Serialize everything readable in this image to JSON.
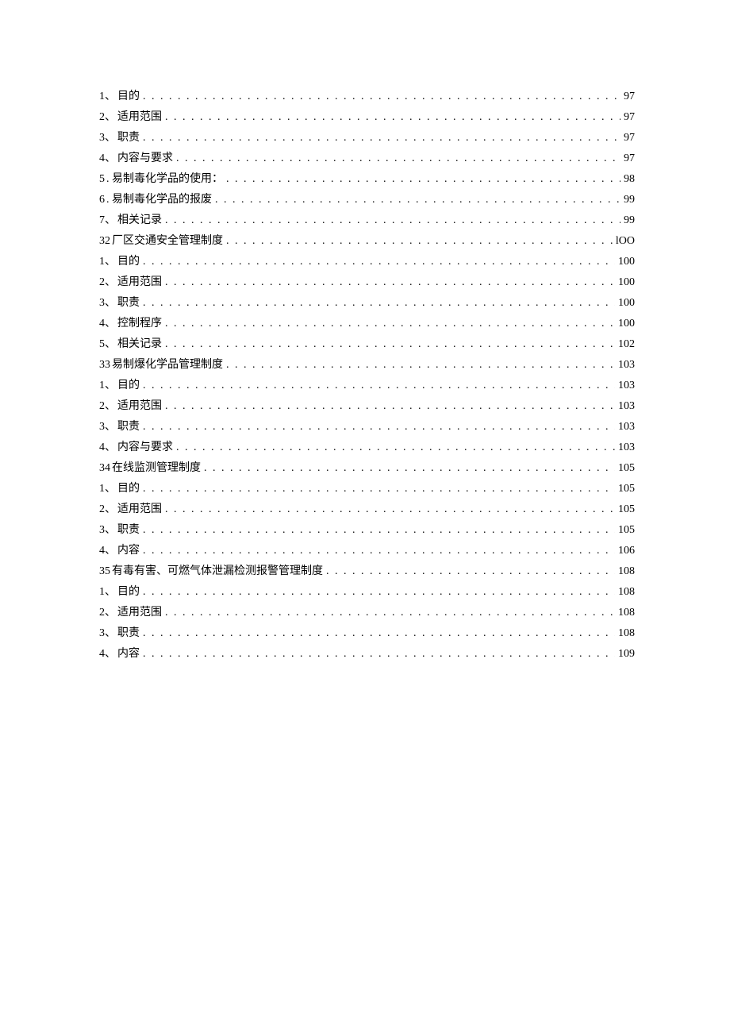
{
  "toc": [
    {
      "prefix": "1、",
      "title": "目的",
      "page": "97"
    },
    {
      "prefix": "2、",
      "title": "适用范围",
      "page": "97"
    },
    {
      "prefix": "3、",
      "title": "职责",
      "page": "97"
    },
    {
      "prefix": "4、",
      "title": "内容与要求",
      "page": "97"
    },
    {
      "prefix": "5",
      "title": ". 易制毒化学品的使用：",
      "page": "98"
    },
    {
      "prefix": "6",
      "title": ". 易制毒化学品的报废",
      "page": "99"
    },
    {
      "prefix": "7、",
      "title": "相关记录",
      "page": "99"
    },
    {
      "prefix": "32",
      "title": " 厂区交通安全管理制度",
      "page": "lOO"
    },
    {
      "prefix": "1、",
      "title": "目的",
      "page": "100"
    },
    {
      "prefix": "2、",
      "title": "适用范围",
      "page": "100"
    },
    {
      "prefix": "3、",
      "title": "职责",
      "page": "100"
    },
    {
      "prefix": "4、",
      "title": "控制程序",
      "page": "100"
    },
    {
      "prefix": "5、",
      "title": "相关记录",
      "page": "102"
    },
    {
      "prefix": "33",
      "title": " 易制爆化学品管理制度",
      "page": "103"
    },
    {
      "prefix": "1、",
      "title": "目的",
      "page": "103"
    },
    {
      "prefix": "2、",
      "title": "适用范围",
      "page": "103"
    },
    {
      "prefix": "3、",
      "title": "职责",
      "page": "103"
    },
    {
      "prefix": "4、",
      "title": "内容与要求",
      "page": "103"
    },
    {
      "prefix": "34",
      "title": " 在线监测管理制度",
      "page": "105"
    },
    {
      "prefix": "1、",
      "title": "目的",
      "page": "105"
    },
    {
      "prefix": "2、",
      "title": "适用范围",
      "page": "105"
    },
    {
      "prefix": "3、",
      "title": "职责",
      "page": "105"
    },
    {
      "prefix": "4、",
      "title": "内容",
      "page": "106"
    },
    {
      "prefix": "35",
      "title": " 有毒有害、可燃气体泄漏检测报警管理制度",
      "page": "108"
    },
    {
      "prefix": "1、",
      "title": "目的",
      "page": "108"
    },
    {
      "prefix": "2、",
      "title": "适用范围",
      "page": "108"
    },
    {
      "prefix": "3、",
      "title": "职责",
      "page": "108"
    },
    {
      "prefix": "4、",
      "title": "内容",
      "page": "109"
    }
  ]
}
